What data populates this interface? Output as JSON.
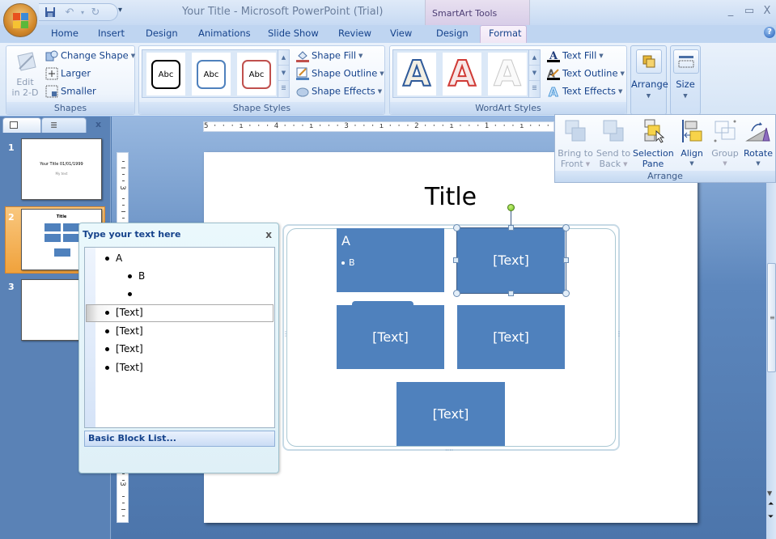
{
  "window": {
    "title": "Your Title  -  Microsoft PowerPoint (Trial)",
    "contextual_group": "SmartArt Tools",
    "controls": {
      "minimize": "_",
      "maximize": "▭",
      "close": "X"
    }
  },
  "quick_access": {
    "save": "save-icon",
    "undo": "↶",
    "redo": "↻",
    "customize": "▾"
  },
  "tabs": [
    "Home",
    "Insert",
    "Design",
    "Animations",
    "Slide Show",
    "Review",
    "View",
    "Design",
    "Format"
  ],
  "active_tab": "Format",
  "help_label": "?",
  "ribbon": {
    "shapes": {
      "label": "Shapes",
      "edit_2d": [
        "Edit",
        "in 2-D"
      ],
      "change_shape": "Change Shape",
      "larger": "Larger",
      "smaller": "Smaller"
    },
    "shape_styles": {
      "label": "Shape Styles",
      "gallery": [
        "Abc",
        "Abc",
        "Abc"
      ],
      "gallery_colors": [
        "#000000",
        "#4f81bd",
        "#c0504d"
      ],
      "shape_fill": "Shape Fill",
      "shape_outline": "Shape Outline",
      "shape_effects": "Shape Effects"
    },
    "wordart_styles": {
      "label": "WordArt Styles",
      "gallery": [
        "A",
        "A",
        "A"
      ],
      "text_fill": "Text Fill",
      "text_outline": "Text Outline",
      "text_effects": "Text Effects"
    },
    "arrange_button": "Arrange",
    "size_button": "Size"
  },
  "arrange_popup": {
    "label": "Arrange",
    "buttons": [
      {
        "line1": "Bring to",
        "line2": "Front",
        "enabled": false
      },
      {
        "line1": "Send to",
        "line2": "Back",
        "enabled": false
      },
      {
        "line1": "Selection",
        "line2": "Pane",
        "enabled": true
      },
      {
        "line1": "Align",
        "line2": "",
        "enabled": true
      },
      {
        "line1": "Group",
        "line2": "",
        "enabled": false
      },
      {
        "line1": "Rotate",
        "line2": "",
        "enabled": true
      }
    ]
  },
  "slides_pane": {
    "slides": [
      {
        "number": "1",
        "title": "Your Title 01/01/1999",
        "subtitle": "My text"
      },
      {
        "number": "2",
        "title": "Title"
      },
      {
        "number": "3"
      }
    ],
    "selected": 2
  },
  "ruler": {
    "horizontal": "5 · · · ı · · · 4 · · · ı · · · 3 · · · ı · · · 2 · · · ı · · · 1 · · · ı · · · 0 · · · ı · · · 1 · · · ı · · · 2",
    "vertical_label": "3"
  },
  "slide": {
    "title": "Title",
    "smartart": {
      "layout": "Basic Block List...",
      "blocks": [
        {
          "text": "A",
          "bullet": "B"
        },
        {
          "text": "[Text]",
          "selected": true
        },
        {
          "text": "[Text]"
        },
        {
          "text": "[Text]"
        },
        {
          "text": "[Text]"
        }
      ]
    }
  },
  "text_pane": {
    "title": "Type your text here",
    "close": "x",
    "items": [
      {
        "level": 1,
        "text": "A"
      },
      {
        "level": 2,
        "text": "B"
      },
      {
        "level": 2,
        "text": ""
      },
      {
        "level": 1,
        "text": "[Text]",
        "selected": true
      },
      {
        "level": 1,
        "text": "[Text]"
      },
      {
        "level": 1,
        "text": "[Text]"
      },
      {
        "level": 1,
        "text": "[Text]"
      }
    ],
    "footer": "Basic Block List..."
  },
  "colors": {
    "block_fill": "#4f81bd",
    "accent_orange": "#f0a23c",
    "ribbon_text": "#15428b"
  }
}
